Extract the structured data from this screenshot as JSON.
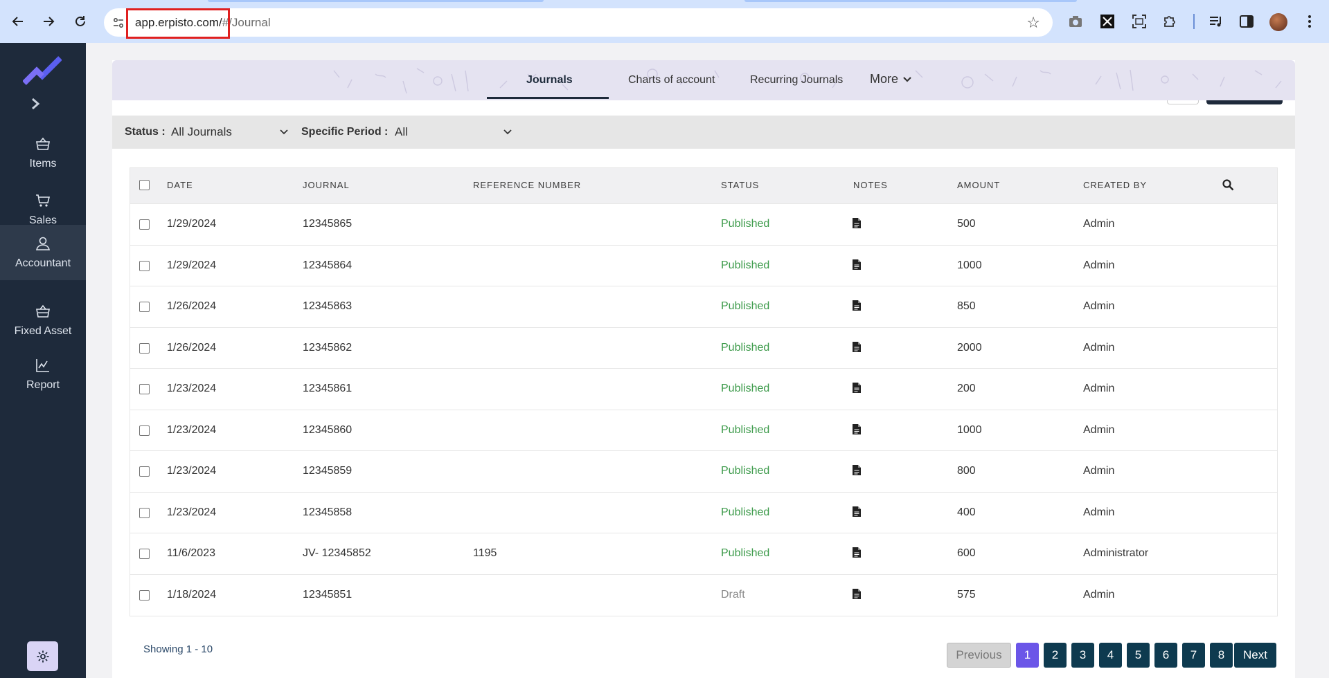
{
  "browser": {
    "url_host": "app.erpisto.com/",
    "url_path": "#/Journal"
  },
  "sidebar": {
    "items": [
      {
        "label": "Items",
        "icon": "basket-icon"
      },
      {
        "label": "Sales",
        "icon": "cart-icon"
      },
      {
        "label": "Accountant",
        "icon": "user-icon"
      },
      {
        "label": "Fixed Asset",
        "icon": "basket-icon"
      },
      {
        "label": "Report",
        "icon": "chart-icon"
      }
    ],
    "active": "Accountant"
  },
  "topnav": {
    "tabs": [
      "Journals",
      "Charts of account",
      "Recurring Journals"
    ],
    "more_label": "More"
  },
  "filters": {
    "status_label": "Status :",
    "status_value": "All Journals",
    "period_label": "Specific Period :",
    "period_value": "All"
  },
  "table": {
    "headers": [
      "Date",
      "Journal",
      "Reference Number",
      "Status",
      "Notes",
      "Amount",
      "Created By"
    ],
    "rows": [
      {
        "date": "1/29/2024",
        "journal": "12345865",
        "ref": "",
        "status": "Published",
        "amount": "500",
        "created_by": "Admin"
      },
      {
        "date": "1/29/2024",
        "journal": "12345864",
        "ref": "",
        "status": "Published",
        "amount": "1000",
        "created_by": "Admin"
      },
      {
        "date": "1/26/2024",
        "journal": "12345863",
        "ref": "",
        "status": "Published",
        "amount": "850",
        "created_by": "Admin"
      },
      {
        "date": "1/26/2024",
        "journal": "12345862",
        "ref": "",
        "status": "Published",
        "amount": "2000",
        "created_by": "Admin"
      },
      {
        "date": "1/23/2024",
        "journal": "12345861",
        "ref": "",
        "status": "Published",
        "amount": "200",
        "created_by": "Admin"
      },
      {
        "date": "1/23/2024",
        "journal": "12345860",
        "ref": "",
        "status": "Published",
        "amount": "1000",
        "created_by": "Admin"
      },
      {
        "date": "1/23/2024",
        "journal": "12345859",
        "ref": "",
        "status": "Published",
        "amount": "800",
        "created_by": "Admin"
      },
      {
        "date": "1/23/2024",
        "journal": "12345858",
        "ref": "",
        "status": "Published",
        "amount": "400",
        "created_by": "Admin"
      },
      {
        "date": "11/6/2023",
        "journal": "JV- 12345852",
        "ref": "1195",
        "status": "Published",
        "amount": "600",
        "created_by": "Administrator"
      },
      {
        "date": "1/18/2024",
        "journal": "12345851",
        "ref": "",
        "status": "Draft",
        "amount": "575",
        "created_by": "Admin"
      }
    ]
  },
  "pagination": {
    "showing": "Showing 1 - 10",
    "previous": "Previous",
    "pages": [
      "1",
      "2",
      "3",
      "4",
      "5",
      "6",
      "7",
      "8"
    ],
    "current": "1",
    "next": "Next"
  },
  "colors": {
    "sidebar_bg": "#1e2a3b",
    "published": "#3c9a4a",
    "draft": "#8a8a8a",
    "page_active": "#6b56e8",
    "page_btn": "#0e3a4f"
  }
}
